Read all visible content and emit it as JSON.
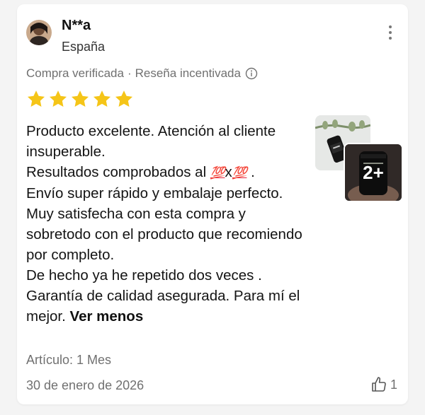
{
  "reviewer": {
    "name": "N**a",
    "country": "España",
    "avatar_icon": "user-avatar-photo"
  },
  "meta": {
    "verified": "Compra verificada",
    "separator": "·",
    "incentivized": "Reseña incentivada",
    "info_icon": "info-icon"
  },
  "rating": {
    "value": 5,
    "max": 5,
    "color": "#f5c518"
  },
  "review": {
    "lines": [
      "Producto excelente. Atención al cliente insuperable.",
      "Resultados comprobados al",
      "Envío super rápido y embalaje perfecto.",
      "Muy satisfecha con esta compra y sobretodo con el producto que recomiendo por completo.",
      "De hecho ya he repetido dos veces .",
      "Garantía de calidad asegurada. Para mí el mejor."
    ],
    "emoji_text": "💯",
    "emoji_times": "x",
    "emoji_end": ".",
    "see_less": "Ver menos"
  },
  "photos": {
    "more_count": "2+"
  },
  "article": "Artículo: 1 Mes",
  "date": "30 de enero de 2026",
  "helpful": {
    "count": "1",
    "icon": "thumbs-up-icon"
  }
}
